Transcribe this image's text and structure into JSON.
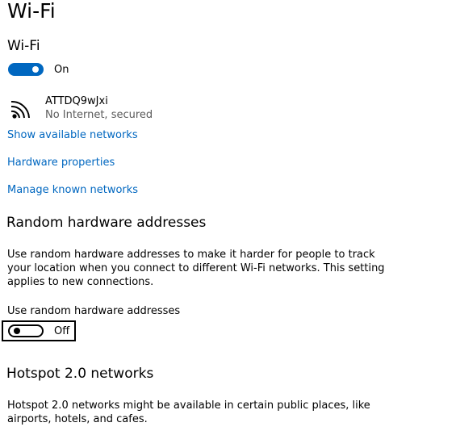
{
  "page": {
    "title": "Wi-Fi"
  },
  "wifi": {
    "section_title": "Wi-Fi",
    "toggle_state": "On",
    "toggle_on": true,
    "accent_color": "#0067c0"
  },
  "network": {
    "icon": "wifi-signal-icon",
    "name": "ATTDQ9wJxi",
    "status": "No Internet, secured"
  },
  "links": {
    "show_networks": "Show available networks",
    "hardware_properties": "Hardware properties",
    "manage_networks": "Manage known networks"
  },
  "random_hw": {
    "title": "Random hardware addresses",
    "description": "Use random hardware addresses to make it harder for people to track your location when you connect to different Wi-Fi networks. This setting applies to new connections.",
    "setting_label": "Use random hardware addresses",
    "toggle_state": "Off",
    "toggle_on": false
  },
  "hotspot": {
    "title": "Hotspot 2.0 networks",
    "description": "Hotspot 2.0 networks might be available in certain public places, like airports, hotels, and cafes."
  }
}
